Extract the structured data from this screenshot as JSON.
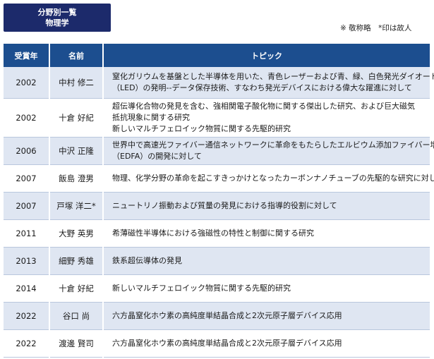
{
  "header": {
    "title_line1": "分野別一覧",
    "title_line2": "物理学",
    "note": "※ 敬称略　*印は故人"
  },
  "table": {
    "columns": [
      "受賞年",
      "名前",
      "トピック"
    ],
    "rows": [
      {
        "year": "2002",
        "name": "中村 修二",
        "topic": [
          "窒化ガリウムを基盤とした半導体を用いた、青色レーザーおよび青、緑、白色発光ダイオード",
          "（LED）の発明--データ保存技術、すなわち発光デバイスにおける偉大な躍進に対して"
        ]
      },
      {
        "year": "2002",
        "name": "十倉 好紀",
        "topic": [
          "超伝導化合物の発見を含む、強相関電子酸化物に関する傑出した研究、および巨大磁気",
          "抵抗現象に関する研究",
          "新しいマルチフェロイック物質に関する先駆的研究"
        ]
      },
      {
        "year": "2006",
        "name": "中沢 正隆",
        "topic": [
          "世界中で高速光ファイバー通信ネットワークに革命をもたらしたエルビウム添加ファイバー増幅器",
          "（EDFA）の開発に対して"
        ]
      },
      {
        "year": "2007",
        "name": "飯島 澄男",
        "topic": [
          "物理、化学分野の革命を起こすきっかけとなったカーボンナノチューブの先駆的な研究に対して"
        ]
      },
      {
        "year": "2007",
        "name": "戸塚 洋二*",
        "topic": [
          "ニュートリノ振動および質量の発見における指導的役割に対して"
        ]
      },
      {
        "year": "2011",
        "name": "大野 英男",
        "topic": [
          "希薄磁性半導体における強磁性の特性と制御に関する研究"
        ]
      },
      {
        "year": "2013",
        "name": "細野 秀雄",
        "topic": [
          "鉄系超伝導体の発見"
        ]
      },
      {
        "year": "2014",
        "name": "十倉 好紀",
        "topic": [
          "新しいマルチフェロイック物質に関する先駆的研究"
        ]
      },
      {
        "year": "2022",
        "name": "谷口 尚",
        "topic": [
          "六方晶窒化ホウ素の高純度単結晶合成と2次元原子層デバイス応用"
        ]
      },
      {
        "year": "2022",
        "name": "渡邊 賢司",
        "topic": [
          "六方晶窒化ホウ素の高純度単結晶合成と2次元原子層デバイス応用"
        ]
      }
    ]
  },
  "colors": {
    "title_bg": "#1c2a6b",
    "header_bg": "#1c4e8f",
    "row_shade": "#dfe6f2"
  }
}
